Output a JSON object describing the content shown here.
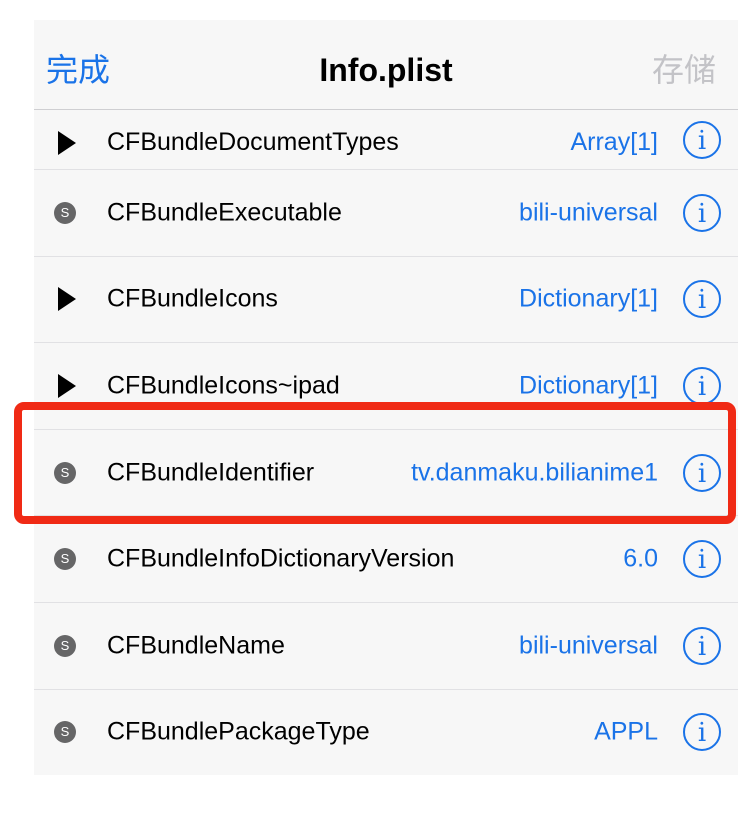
{
  "nav": {
    "done_label": "完成",
    "title": "Info.plist",
    "save_label": "存储"
  },
  "rows": [
    {
      "kind": "array",
      "key": "CFBundleDocumentTypes",
      "value": "Array[1]"
    },
    {
      "kind": "string",
      "key": "CFBundleExecutable",
      "value": "bili-universal"
    },
    {
      "kind": "dict",
      "key": "CFBundleIcons",
      "value": "Dictionary[1]"
    },
    {
      "kind": "dict",
      "key": "CFBundleIcons~ipad",
      "value": "Dictionary[1]"
    },
    {
      "kind": "string",
      "key": "CFBundleIdentifier",
      "value": "tv.danmaku.bilianime1"
    },
    {
      "kind": "string",
      "key": "CFBundleInfoDictionaryVersion",
      "value": "6.0"
    },
    {
      "kind": "string",
      "key": "CFBundleName",
      "value": "bili-universal"
    },
    {
      "kind": "string",
      "key": "CFBundlePackageType",
      "value": "APPL"
    }
  ],
  "badge_letter": "S",
  "info_icon_glyph": "i",
  "colors": {
    "accent": "#1a73e8",
    "highlight": "#f02a15",
    "badge": "#666667",
    "disabled": "#c3c3c7"
  }
}
